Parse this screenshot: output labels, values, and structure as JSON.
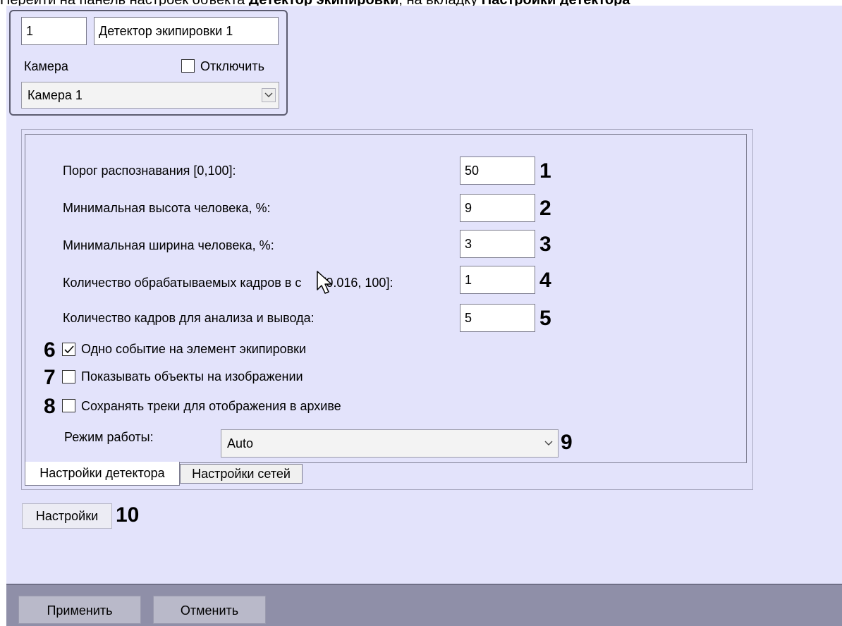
{
  "heading": {
    "part1": "Перейти на панель настроек объекта",
    "part2": "Детектор экипировки",
    "part3": ", на вкладку",
    "part4": "Настройки детектора"
  },
  "object": {
    "id": "1",
    "name": "Детектор экипировки 1",
    "camera_label": "Камера",
    "disable_label": "Отключить",
    "disable_checked": false,
    "camera_value": "Камера 1"
  },
  "settings": {
    "fields": [
      {
        "label": "Порог распознавания [0,100]:",
        "value": "50",
        "marker": "1"
      },
      {
        "label": "Минимальная высота человека, %:",
        "value": "9",
        "marker": "2"
      },
      {
        "label": "Минимальная ширина человека, %:",
        "value": "3",
        "marker": "3"
      },
      {
        "label_before": "Количество обрабатываемых кадров в с",
        "label_after": "[0.016, 100]:",
        "value": "1",
        "marker": "4"
      },
      {
        "label": "Количество кадров для анализа и вывода:",
        "value": "5",
        "marker": "5"
      }
    ],
    "checkboxes": [
      {
        "label": "Одно событие на элемент экипировки",
        "checked": true,
        "marker": "6"
      },
      {
        "label": "Показывать объекты на изображении",
        "checked": false,
        "marker": "7"
      },
      {
        "label": "Сохранять треки для отображения в архиве",
        "checked": false,
        "marker": "8"
      }
    ],
    "mode_label": "Режим работы:",
    "mode_value": "Auto",
    "mode_marker": "9"
  },
  "tabs": [
    {
      "label": "Настройки детектора",
      "active": true
    },
    {
      "label": "Настройки сетей",
      "active": false
    }
  ],
  "settings_button": {
    "label": "Настройки",
    "marker": "10"
  },
  "footer": {
    "apply_label": "Применить",
    "cancel_label": "Отменить"
  }
}
